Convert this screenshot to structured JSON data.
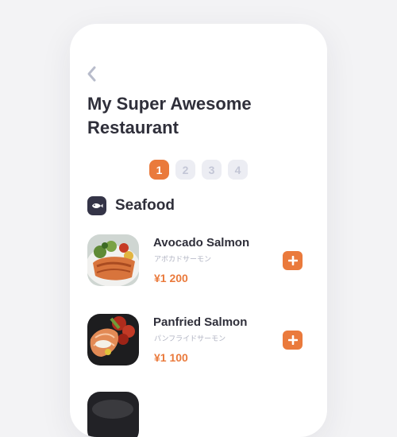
{
  "header": {
    "back_icon": "chevron-left-icon",
    "title": "My Super Awesome Restaurant"
  },
  "steps": [
    {
      "label": "1",
      "active": true
    },
    {
      "label": "2",
      "active": false
    },
    {
      "label": "3",
      "active": false
    },
    {
      "label": "4",
      "active": false
    }
  ],
  "category": {
    "icon": "fish-icon",
    "label": "Seafood"
  },
  "menu": {
    "items": [
      {
        "name": "Avocado Salmon",
        "subtitle": "アボカドサーモン",
        "price": "¥1 200"
      },
      {
        "name": "Panfried Salmon",
        "subtitle": "パンフライドサーモン",
        "price": "¥1 100"
      }
    ]
  },
  "colors": {
    "accent": "#ea7a3c",
    "text": "#2f2f3a",
    "muted": "#b0b3c2"
  }
}
